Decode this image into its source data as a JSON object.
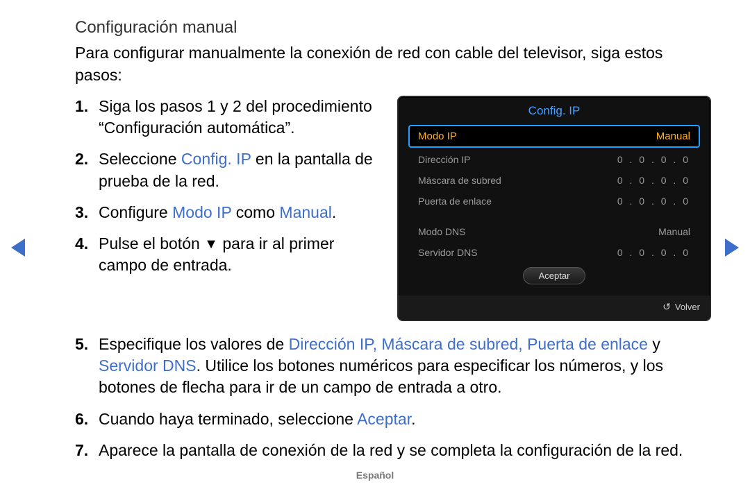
{
  "title": "Configuración manual",
  "intro": "Para configurar manualmente la conexión de red con cable del televisor, siga estos pasos:",
  "steps_top": [
    {
      "n": "1.",
      "before": "Siga los pasos 1 y 2 del procedimiento “Configuración automática”."
    },
    {
      "n": "2.",
      "before": "Seleccione ",
      "hi": "Config. IP",
      "after": " en la pantalla de prueba de la red."
    },
    {
      "n": "3.",
      "before": "Configure ",
      "hi": "Modo IP",
      "mid": " como ",
      "hi2": "Manual",
      "after": "."
    },
    {
      "n": "4.",
      "before": "Pulse el botón ",
      "glyph": "▼",
      "after": " para ir al primer campo de entrada."
    }
  ],
  "steps_bottom": [
    {
      "n": "5.",
      "before": "Especifique los valores de ",
      "hi": "Dirección IP, Máscara de subred, Puerta de enlace",
      "mid": " y ",
      "hi2": "Servidor DNS",
      "after": ". Utilice los botones numéricos para especificar los números, y los botones de flecha para ir de un campo de entrada a otro."
    },
    {
      "n": "6.",
      "before": "Cuando haya terminado, seleccione ",
      "hi": "Aceptar",
      "after": "."
    },
    {
      "n": "7.",
      "before": "Aparece la pantalla de conexión de la red y se completa la configuración de la red."
    }
  ],
  "dialog": {
    "title": "Config. IP",
    "selected": {
      "label": "Modo IP",
      "value": "Manual"
    },
    "rows1": [
      {
        "label": "Dirección IP",
        "value": "0 . 0 . 0 . 0"
      },
      {
        "label": "Máscara de subred",
        "value": "0 . 0 . 0 . 0"
      },
      {
        "label": "Puerta de enlace",
        "value": "0 . 0 . 0 . 0"
      }
    ],
    "rows2": [
      {
        "label": "Modo DNS",
        "value": "Manual"
      },
      {
        "label": "Servidor DNS",
        "value": "0 . 0 . 0 . 0"
      }
    ],
    "ok": "Aceptar",
    "back": "Volver",
    "back_icon": "↺"
  },
  "lang": "Español"
}
